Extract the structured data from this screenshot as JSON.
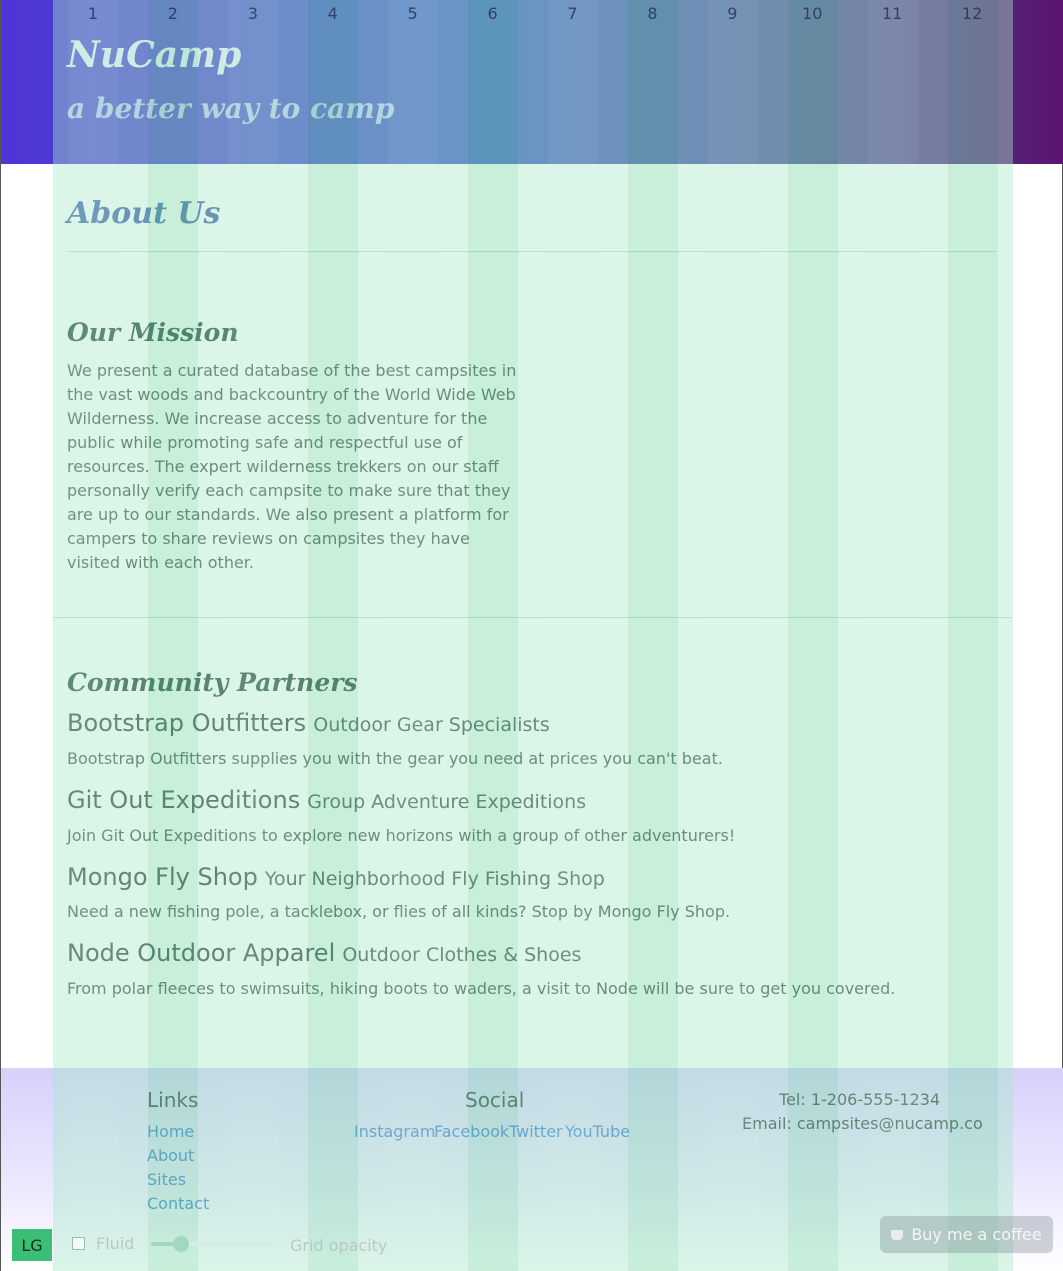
{
  "header": {
    "brand": "NuCamp",
    "tagline": "a better way to camp"
  },
  "page": {
    "title": "About Us"
  },
  "mission": {
    "title": "Our Mission",
    "text": "We present a curated database of the best campsites in the vast woods and backcountry of the World Wide Web Wilderness. We increase access to adventure for the public while promoting safe and respectful use of resources. The expert wilderness trekkers on our staff personally verify each campsite to make sure that they are up to our standards. We also present a platform for campers to share reviews on campsites they have visited with each other."
  },
  "partners": {
    "title": "Community Partners",
    "items": [
      {
        "name": "Bootstrap Outfitters",
        "subtitle": "Outdoor Gear Specialists",
        "description": "Bootstrap Outfitters supplies you with the gear you need at prices you can't beat."
      },
      {
        "name": "Git Out Expeditions",
        "subtitle": "Group Adventure Expeditions",
        "description": "Join Git Out Expeditions to explore new horizons with a group of other adventurers!"
      },
      {
        "name": "Mongo Fly Shop",
        "subtitle": "Your Neighborhood Fly Fishing Shop",
        "description": "Need a new fishing pole, a tacklebox, or flies of all kinds? Stop by Mongo Fly Shop."
      },
      {
        "name": "Node Outdoor Apparel",
        "subtitle": "Outdoor Clothes & Shoes",
        "description": "From polar fleeces to swimsuits, hiking boots to waders, a visit to Node will be sure to get you covered."
      }
    ]
  },
  "footer": {
    "links": {
      "heading": "Links",
      "items": [
        "Home",
        "About",
        "Sites",
        "Contact"
      ]
    },
    "social": {
      "heading": "Social",
      "items": [
        "Instagram",
        "Facebook",
        "Twitter",
        "YouTube"
      ]
    },
    "contact": {
      "tel": "Tel: 1-206-555-1234",
      "email": "Email: campsites@nucamp.co"
    }
  },
  "grid_tool": {
    "columns": [
      "1",
      "2",
      "3",
      "4",
      "5",
      "6",
      "7",
      "8",
      "9",
      "10",
      "11",
      "12"
    ],
    "breakpoint": "LG",
    "fluid_label": "Fluid",
    "fluid_checked": false,
    "opacity_label": "Grid opacity",
    "opacity_value": 0.2
  },
  "coffee": {
    "label": "Buy me a coffee"
  },
  "colors": {
    "header_start": "#4f35d6",
    "header_end": "#5a1470",
    "link": "#3478d6",
    "title": "#3b5ba8"
  }
}
